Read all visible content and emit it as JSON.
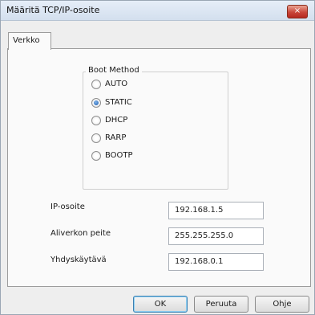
{
  "window": {
    "title": "Määritä TCP/IP-osoite",
    "close_glyph": "×"
  },
  "tabs": [
    {
      "label": "Verkko",
      "selected": true
    }
  ],
  "boot_method": {
    "title": "Boot Method",
    "selected": "STATIC",
    "options": [
      {
        "label": "AUTO",
        "checked": false
      },
      {
        "label": "STATIC",
        "checked": true
      },
      {
        "label": "DHCP",
        "checked": false
      },
      {
        "label": "RARP",
        "checked": false
      },
      {
        "label": "BOOTP",
        "checked": false
      }
    ]
  },
  "fields": [
    {
      "label": "IP-osoite",
      "value": "192.168.1.5"
    },
    {
      "label": "Aliverkon peite",
      "value": "255.255.255.0"
    },
    {
      "label": "Yhdyskäytävä",
      "value": "192.168.0.1"
    }
  ],
  "buttons": {
    "ok": "OK",
    "cancel": "Peruuta",
    "help": "Ohje"
  },
  "colors": {
    "accent": "#1f5db0",
    "close": "#c9463a"
  }
}
